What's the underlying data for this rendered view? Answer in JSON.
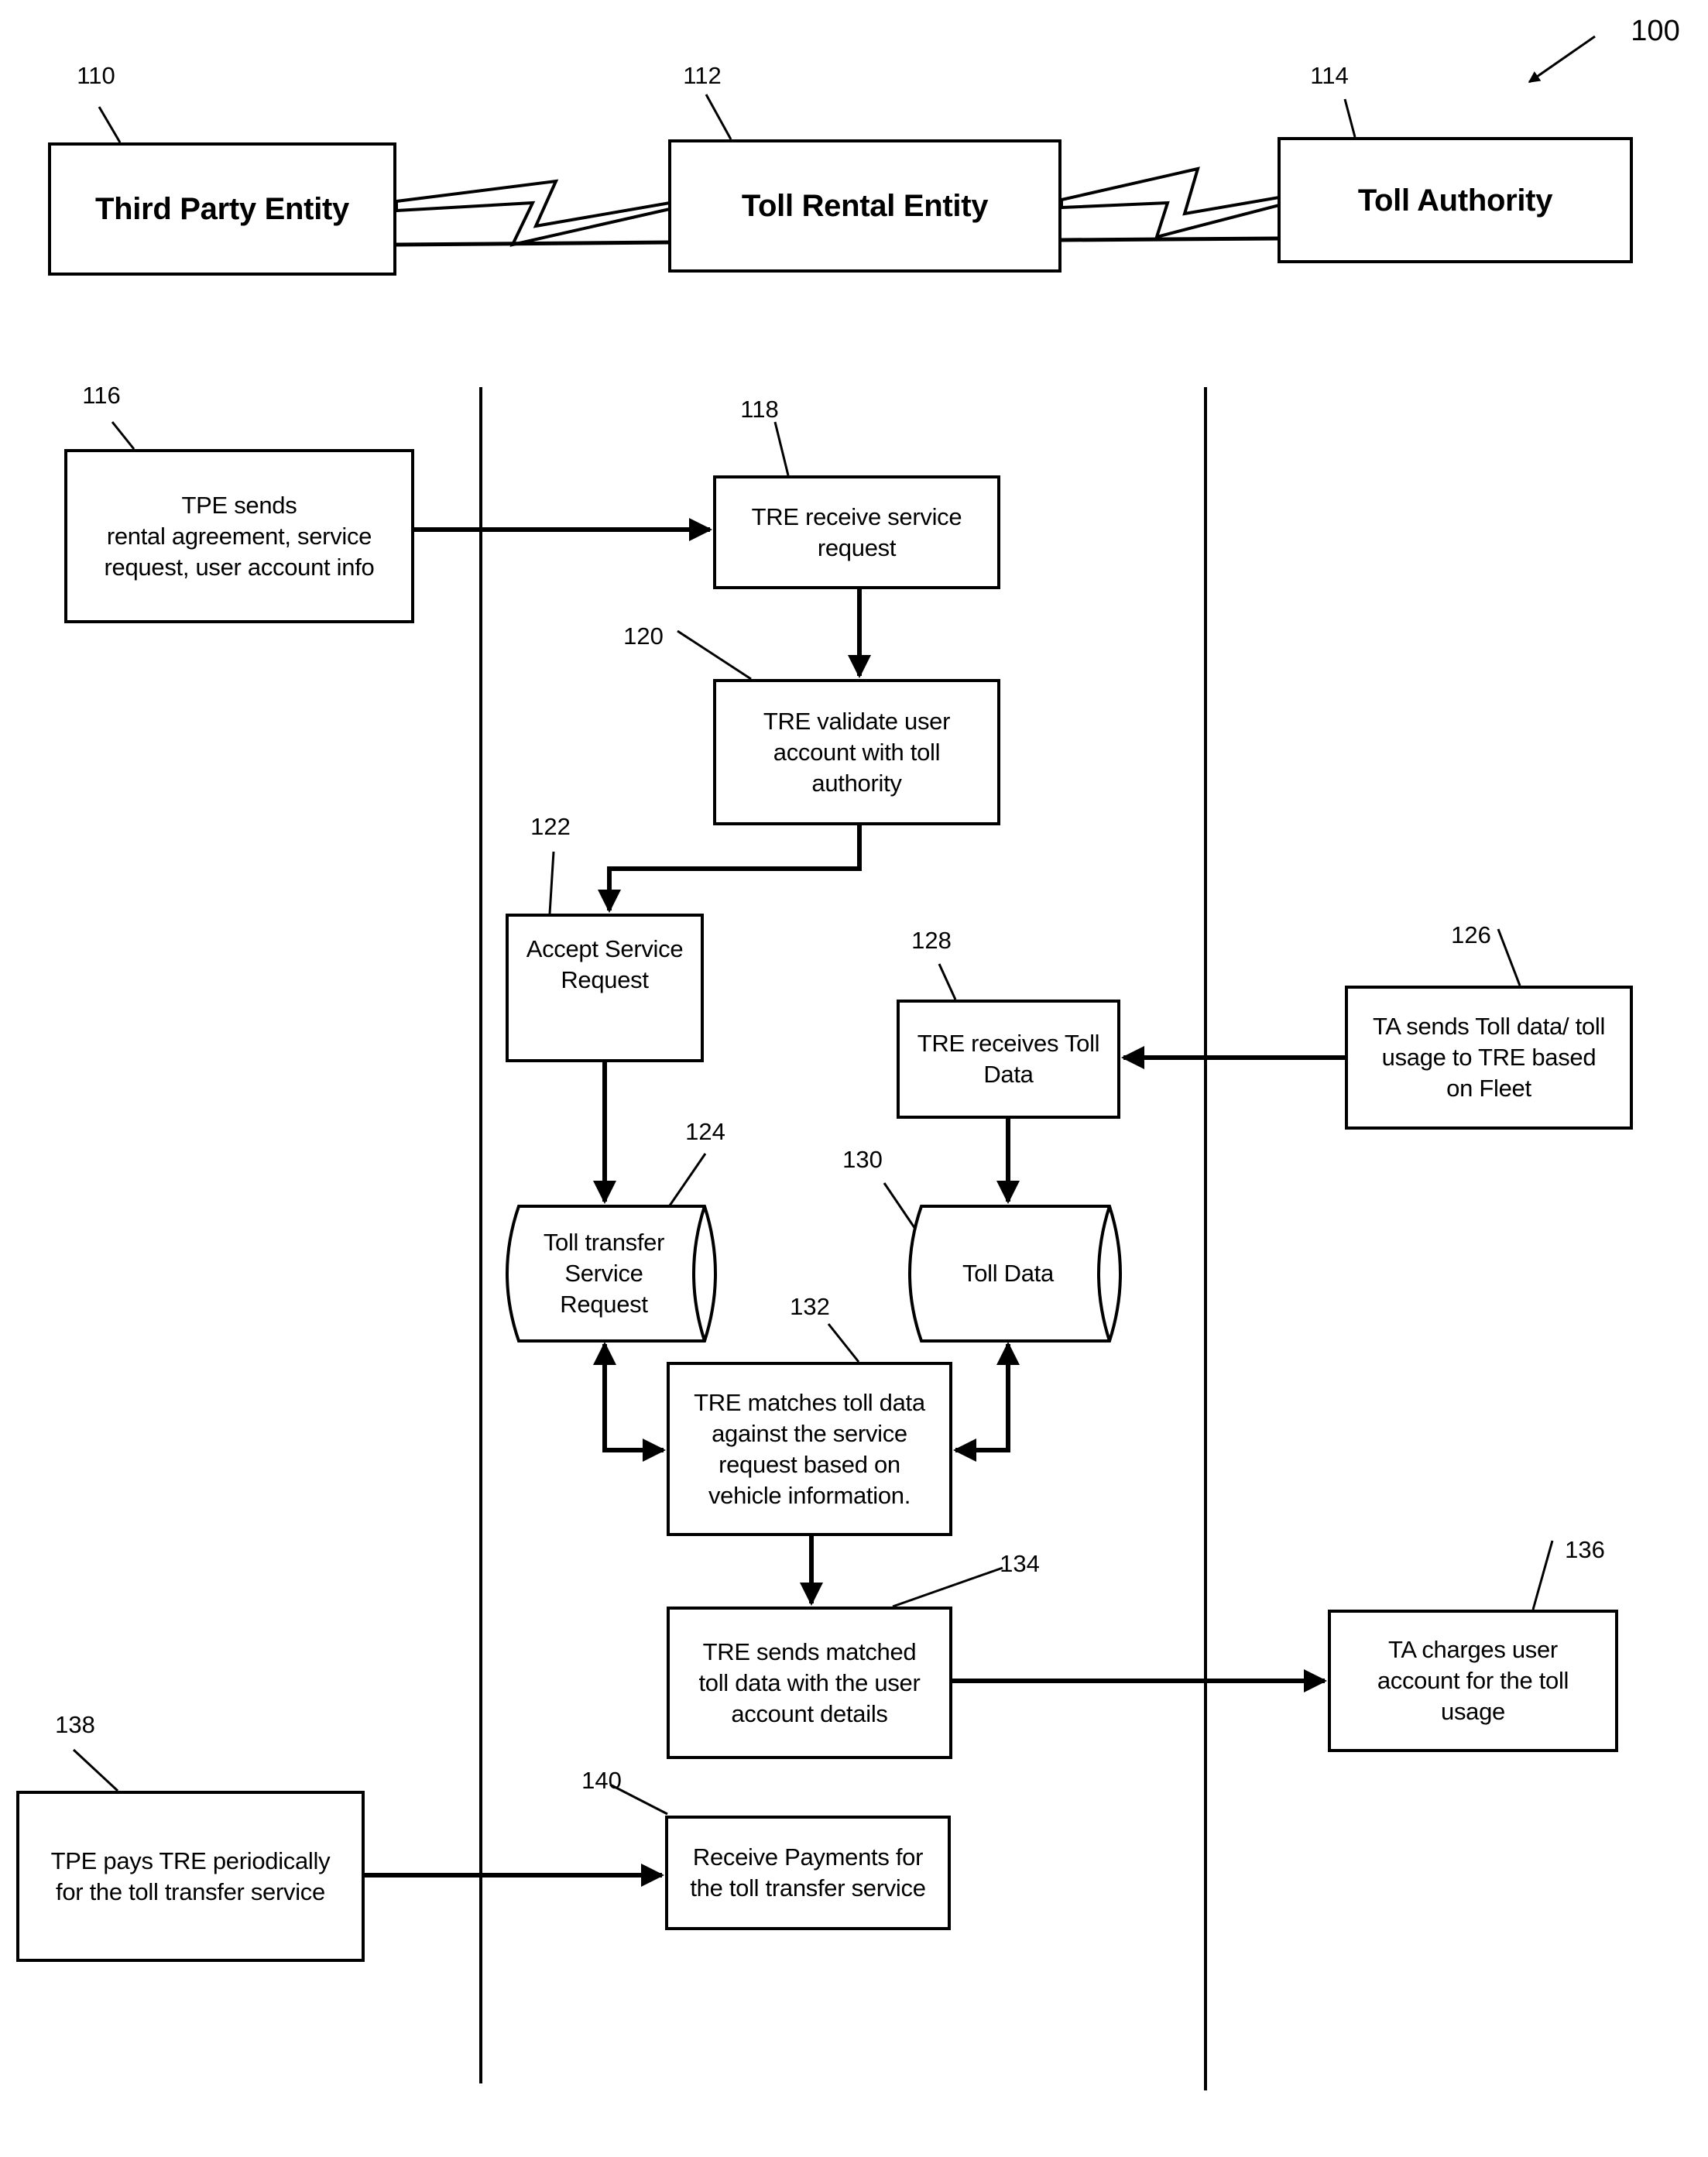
{
  "figure": {
    "ref": "100"
  },
  "entities": [
    {
      "id": "third-party-entity",
      "ref": "110",
      "label": "Third Party Entity"
    },
    {
      "id": "toll-rental-entity",
      "ref": "112",
      "label": "Toll Rental Entity"
    },
    {
      "id": "toll-authority",
      "ref": "114",
      "label": "Toll Authority"
    }
  ],
  "steps": {
    "s116": {
      "ref": "116",
      "text": "TPE sends\nrental agreement, service\nrequest, user account info"
    },
    "s118": {
      "ref": "118",
      "text": "TRE receive service\nrequest"
    },
    "s120": {
      "ref": "120",
      "text": "TRE validate user\naccount with toll\nauthority"
    },
    "s122": {
      "ref": "122",
      "text": "Accept Service\nRequest"
    },
    "s124": {
      "ref": "124",
      "text": "Toll transfer\nService\nRequest"
    },
    "s126": {
      "ref": "126",
      "text": "TA sends Toll data/ toll\nusage to TRE based\non Fleet"
    },
    "s128": {
      "ref": "128",
      "text": "TRE receives Toll\nData"
    },
    "s130": {
      "ref": "130",
      "text": "Toll Data"
    },
    "s132": {
      "ref": "132",
      "text": "TRE matches toll data\nagainst the service\nrequest based on\nvehicle information."
    },
    "s134": {
      "ref": "134",
      "text": "TRE sends matched\ntoll data with the user\naccount details"
    },
    "s136": {
      "ref": "136",
      "text": "TA charges user\naccount for the toll\nusage"
    },
    "s138": {
      "ref": "138",
      "text": "TPE pays TRE periodically\nfor the toll transfer service"
    },
    "s140": {
      "ref": "140",
      "text": "Receive Payments for\nthe toll transfer service"
    }
  },
  "colors": {
    "stroke": "#000000",
    "background": "#ffffff"
  }
}
